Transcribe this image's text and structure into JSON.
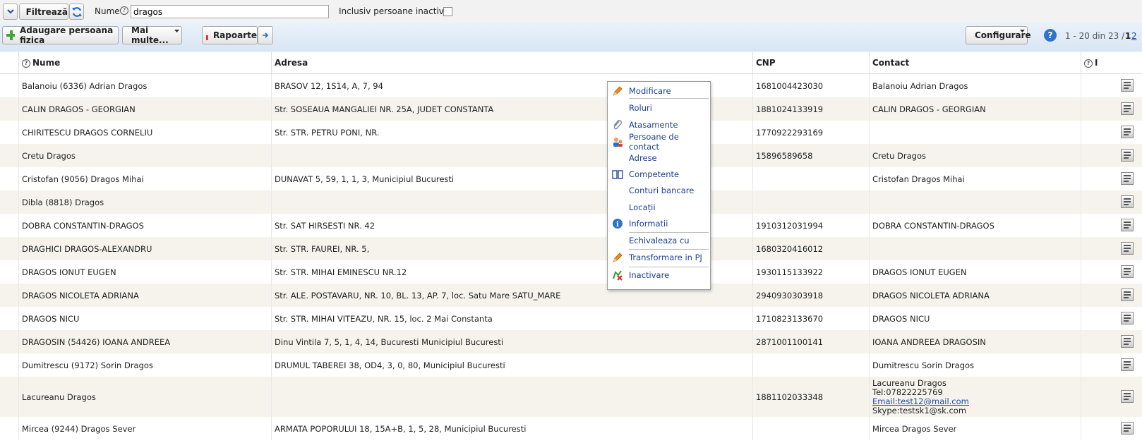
{
  "filter": {
    "filter_label": "Filtrează",
    "name_label": "Nume",
    "name_value": "dragos",
    "inactive_label": "Inclusiv persoane inactive"
  },
  "toolbar": {
    "add_label": "Adaugare persoana fizica",
    "more_label": "Mai multe...",
    "reports_label": "Rapoarte",
    "config_label": "Configurare",
    "range_text": "1 - 20 din 23 /",
    "page1": "1",
    "page2": "2"
  },
  "table": {
    "headers": {
      "name": "Nume",
      "address": "Adresa",
      "cnp": "CNP",
      "contact": "Contact",
      "extra": "I"
    },
    "rows": [
      {
        "name": "Balanoiu (6336) Adrian Dragos",
        "address": "BRASOV 12, 1S14, A, 7, 94",
        "cnp": "1681004423030",
        "contact": "Balanoiu Adrian Dragos"
      },
      {
        "name": "CALIN DRAGOS - GEORGIAN",
        "address": "Str. SOSEAUA MANGALIEI NR. 25A, JUDET CONSTANTA",
        "cnp": "1881024133919",
        "contact": "CALIN DRAGOS - GEORGIAN"
      },
      {
        "name": "CHIRITESCU DRAGOS CORNELIU",
        "address": "Str. STR. PETRU PONI, NR.",
        "cnp": "1770922293169",
        "contact": ""
      },
      {
        "name": "Cretu Dragos",
        "address": "",
        "cnp": "15896589658",
        "contact": "Cretu Dragos"
      },
      {
        "name": "Cristofan (9056) Dragos Mihai",
        "address": "DUNAVAT 5, 59, 1, 1, 3, Municipiul Bucuresti",
        "cnp": "",
        "contact": "Cristofan Dragos Mihai"
      },
      {
        "name": "Dibla (8818) Dragos",
        "address": "",
        "cnp": "",
        "contact": ""
      },
      {
        "name": "DOBRA CONSTANTIN-DRAGOS",
        "address": "Str. SAT HIRSESTI NR. 42",
        "cnp": "1910312031994",
        "contact": "DOBRA CONSTANTIN-DRAGOS"
      },
      {
        "name": "DRAGHICI DRAGOS-ALEXANDRU",
        "address": "Str. STR. FAUREI, NR. 5,",
        "cnp": "1680320416012",
        "contact": ""
      },
      {
        "name": "DRAGOS IONUT EUGEN",
        "address": "Str. STR. MIHAI EMINESCU NR.12",
        "cnp": "1930115133922",
        "contact": "DRAGOS IONUT EUGEN"
      },
      {
        "name": "DRAGOS NICOLETA ADRIANA",
        "address": "Str. ALE. POSTAVARU, NR. 10, BL. 13, AP. 7, loc. Satu Mare SATU_MARE",
        "cnp": "2940930303918",
        "contact": "DRAGOS NICOLETA ADRIANA"
      },
      {
        "name": "DRAGOS NICU",
        "address": "Str. STR. MIHAI VITEAZU, NR. 15, loc. 2 Mai Constanta",
        "cnp": "1710823133670",
        "contact": "DRAGOS NICU"
      },
      {
        "name": "DRAGOSIN (54426) IOANA ANDREEA",
        "address": "Dinu Vintila 7, 5, 1, 4, 14, Bucuresti Municipiul Bucuresti",
        "cnp": "2871001100141",
        "contact": "IOANA ANDREEA DRAGOSIN"
      },
      {
        "name": "Dumitrescu (9172) Sorin Dragos",
        "address": "DRUMUL TABEREI 38, OD4, 3, 0, 80, Municipiul Bucuresti",
        "cnp": "",
        "contact": "Dumitrescu Sorin Dragos"
      },
      {
        "name": "Lacureanu Dragos",
        "address": "",
        "cnp": "1881102033348",
        "contact": ""
      },
      {
        "name": "Mircea (9244) Dragos Sever",
        "address": "ARMATA POPORULUI 18, 15A+B, 1, 5, 28, Municipiul Bucuresti",
        "cnp": "",
        "contact": "Mircea Dragos Sever"
      }
    ],
    "lacureanu_contact": {
      "line1": "Lacureanu Dragos",
      "line2": "Tel:07822225769",
      "line3": "Email:test12@mail.com",
      "line4": "Skype:testsk1@sk.com"
    }
  },
  "context_menu": {
    "items": [
      {
        "label": "Modificare",
        "icon": "pencil-icon"
      },
      {
        "label": "Roluri",
        "icon": ""
      },
      {
        "label": "Atasamente",
        "icon": "paperclip-icon"
      },
      {
        "label": "Persoane de contact",
        "icon": "contacts-icon"
      },
      {
        "label": "Adrese",
        "icon": ""
      },
      {
        "label": "Competente",
        "icon": "book-icon"
      },
      {
        "label": "Conturi bancare",
        "icon": ""
      },
      {
        "label": "Locații",
        "icon": ""
      },
      {
        "label": "Informatii",
        "icon": "info-icon"
      },
      {
        "label": "Echivaleaza cu",
        "icon": ""
      },
      {
        "label": "Transformare in PJ",
        "icon": "pencil-icon"
      },
      {
        "label": "Inactivare",
        "icon": "deactivate-icon"
      }
    ]
  }
}
